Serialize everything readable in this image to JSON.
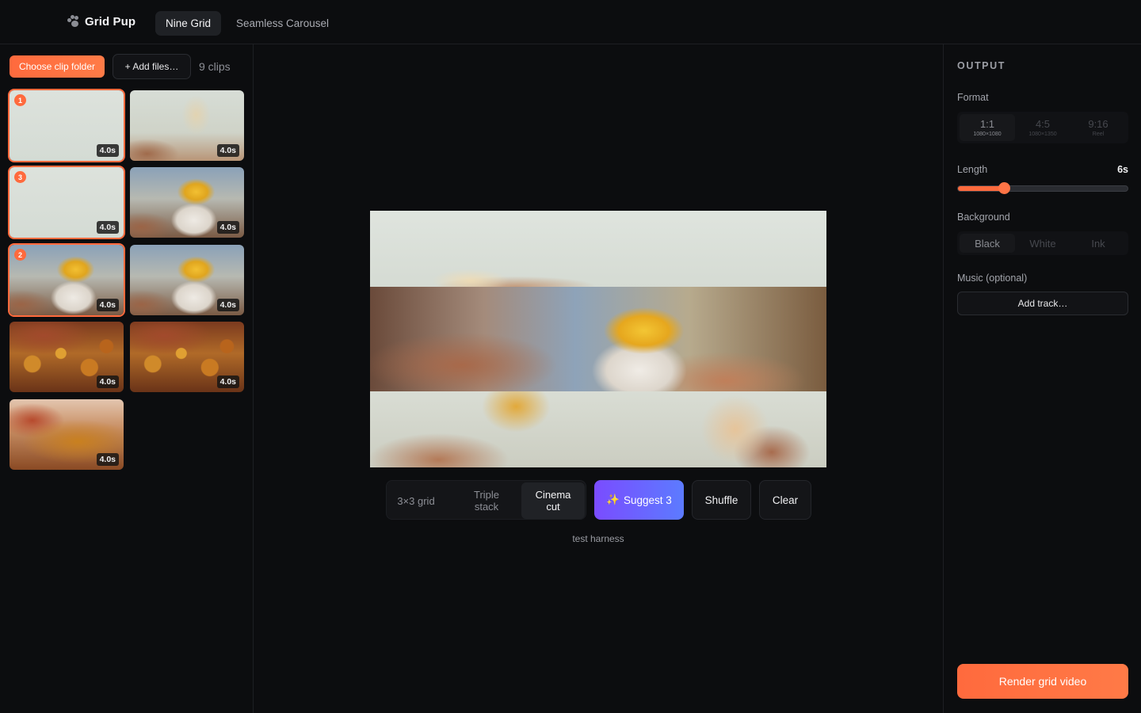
{
  "header": {
    "brand": "Grid Pup",
    "tabs": [
      {
        "label": "Nine Grid",
        "active": true
      },
      {
        "label": "Seamless Carousel",
        "active": false
      }
    ]
  },
  "library": {
    "choose_folder_label": "Choose clip folder",
    "add_files_label": "+ Add files…",
    "clip_count": "9 clips",
    "clips": [
      {
        "duration": "4.0s",
        "order": "1",
        "image": "blank-background"
      },
      {
        "duration": "4.0s",
        "order": "",
        "image": "hand-holding-glass"
      },
      {
        "duration": "4.0s",
        "order": "3",
        "image": "blank-background"
      },
      {
        "duration": "4.0s",
        "order": "",
        "image": "fries-cup"
      },
      {
        "duration": "4.0s",
        "order": "2",
        "image": "fries-cup"
      },
      {
        "duration": "4.0s",
        "order": "",
        "image": "fries-cup"
      },
      {
        "duration": "4.0s",
        "order": "",
        "image": "food-closeup"
      },
      {
        "duration": "4.0s",
        "order": "",
        "image": "food-closeup"
      },
      {
        "duration": "4.0s",
        "order": "",
        "image": "food-closeup"
      }
    ]
  },
  "preview": {
    "layouts": [
      {
        "label": "3×3 grid",
        "active": false
      },
      {
        "label": "Triple stack",
        "active": false
      },
      {
        "label": "Cinema cut",
        "active": true
      }
    ],
    "suggest_label": "Suggest 3",
    "shuffle_label": "Shuffle",
    "clear_label": "Clear",
    "status_text": "test harness"
  },
  "output": {
    "title": "OUTPUT",
    "format_label": "Format",
    "formats": [
      {
        "label": "1:1",
        "sub": "1080×1080",
        "active": true
      },
      {
        "label": "4:5",
        "sub": "1080×1350",
        "active": false
      },
      {
        "label": "9:16",
        "sub": "Reel",
        "active": false
      }
    ],
    "length_label": "Length",
    "length_value": "6s",
    "length_fraction": 0.27,
    "background_label": "Background",
    "backgrounds": [
      {
        "label": "Black",
        "active": true
      },
      {
        "label": "White",
        "active": false
      },
      {
        "label": "Ink",
        "active": false
      }
    ],
    "music_label": "Music (optional)",
    "add_track_label": "Add track…",
    "render_label": "Render grid video"
  },
  "colors": {
    "accent": "#ff6a3d",
    "suggest_gradient_start": "#7a4cff",
    "suggest_gradient_end": "#5c7bff",
    "background": "#0c0d0f"
  }
}
